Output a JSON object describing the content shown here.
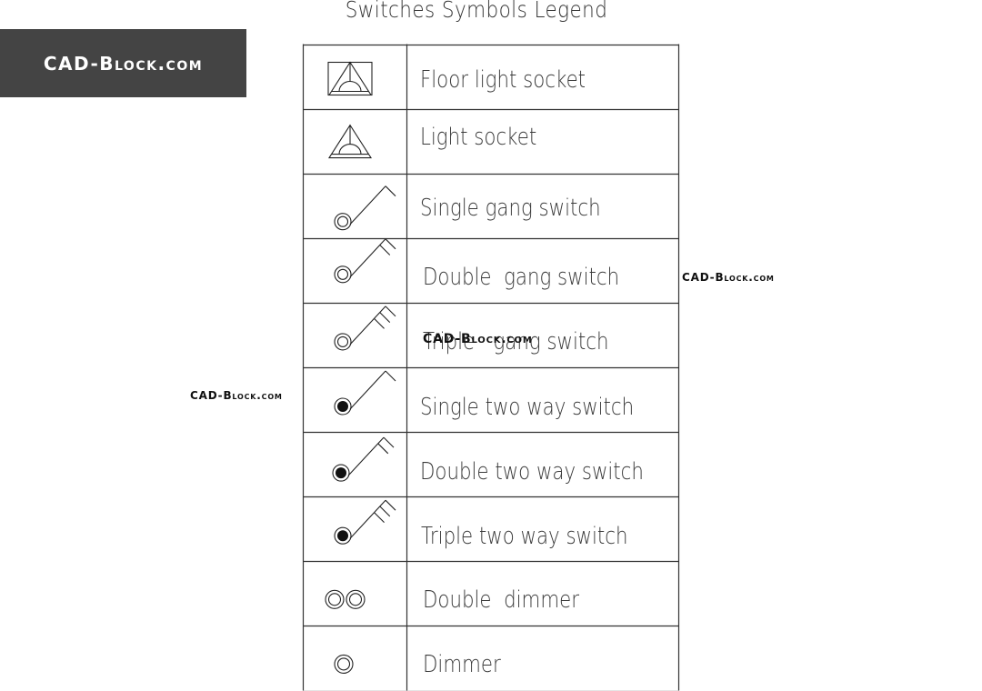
{
  "title": "Switches Symbols Legend",
  "brand": {
    "logo_text": "CAD-Block.com"
  },
  "watermarks": {
    "right": "CAD-Block.com",
    "left": "CAD-Block.com",
    "center": "CAD-Block.com"
  },
  "legend": {
    "rows": [
      {
        "symbol": "floor-light-socket",
        "label": "Floor light socket"
      },
      {
        "symbol": "light-socket",
        "label": "Light socket"
      },
      {
        "symbol": "single-gang-switch",
        "label": "Single gang switch"
      },
      {
        "symbol": "double-gang-switch",
        "label": "Double  gang switch"
      },
      {
        "symbol": "triple-gang-switch",
        "label": "Triple   gang switch"
      },
      {
        "symbol": "single-two-way-switch",
        "label": "Single two way switch"
      },
      {
        "symbol": "double-two-way-switch",
        "label": "Double two way switch"
      },
      {
        "symbol": "triple-two-way-switch",
        "label": "Triple two way switch"
      },
      {
        "symbol": "double-dimmer",
        "label": "Double  dimmer"
      },
      {
        "symbol": "dimmer",
        "label": "Dimmer"
      }
    ]
  },
  "colors": {
    "line": "#333333",
    "brand_bg": "#444444",
    "brand_text": "#ffffff"
  }
}
